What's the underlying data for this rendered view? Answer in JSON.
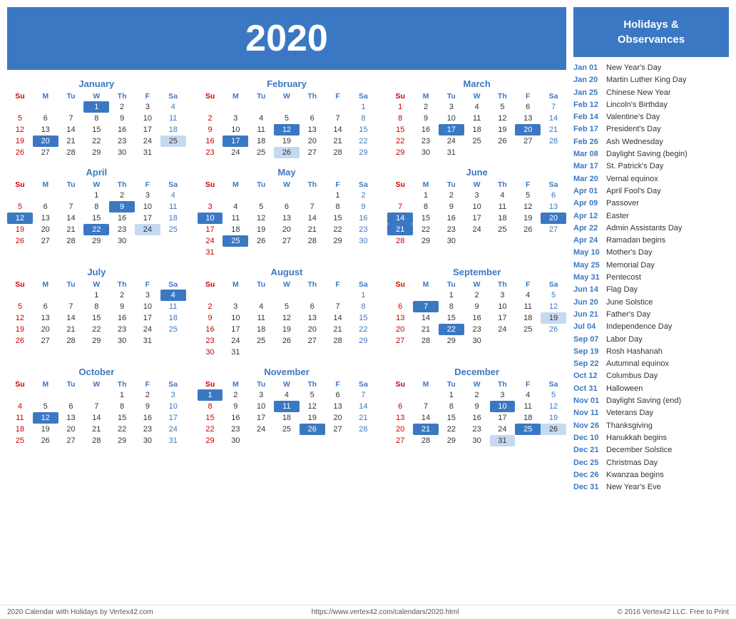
{
  "header": {
    "year": "2020"
  },
  "holidays_header": "Holidays &\nObservances",
  "holidays": [
    {
      "date": "Jan 01",
      "name": "New Year's Day"
    },
    {
      "date": "Jan 20",
      "name": "Martin Luther King Day"
    },
    {
      "date": "Jan 25",
      "name": "Chinese New Year"
    },
    {
      "date": "Feb 12",
      "name": "Lincoln's Birthday"
    },
    {
      "date": "Feb 14",
      "name": "Valentine's Day"
    },
    {
      "date": "Feb 17",
      "name": "President's Day"
    },
    {
      "date": "Feb 26",
      "name": "Ash Wednesday"
    },
    {
      "date": "Mar 08",
      "name": "Daylight Saving (begin)"
    },
    {
      "date": "Mar 17",
      "name": "St. Patrick's Day"
    },
    {
      "date": "Mar 20",
      "name": "Vernal equinox"
    },
    {
      "date": "Apr 01",
      "name": "April Fool's Day"
    },
    {
      "date": "Apr 09",
      "name": "Passover"
    },
    {
      "date": "Apr 12",
      "name": "Easter"
    },
    {
      "date": "Apr 22",
      "name": "Admin Assistants Day"
    },
    {
      "date": "Apr 24",
      "name": "Ramadan begins"
    },
    {
      "date": "May 10",
      "name": "Mother's Day"
    },
    {
      "date": "May 25",
      "name": "Memorial Day"
    },
    {
      "date": "May 31",
      "name": "Pentecost"
    },
    {
      "date": "Jun 14",
      "name": "Flag Day"
    },
    {
      "date": "Jun 20",
      "name": "June Solstice"
    },
    {
      "date": "Jun 21",
      "name": "Father's Day"
    },
    {
      "date": "Jul 04",
      "name": "Independence Day"
    },
    {
      "date": "Sep 07",
      "name": "Labor Day"
    },
    {
      "date": "Sep 19",
      "name": "Rosh Hashanah"
    },
    {
      "date": "Sep 22",
      "name": "Autumnal equinox"
    },
    {
      "date": "Oct 12",
      "name": "Columbus Day"
    },
    {
      "date": "Oct 31",
      "name": "Halloween"
    },
    {
      "date": "Nov 01",
      "name": "Daylight Saving (end)"
    },
    {
      "date": "Nov 11",
      "name": "Veterans Day"
    },
    {
      "date": "Nov 26",
      "name": "Thanksgiving"
    },
    {
      "date": "Dec 10",
      "name": "Hanukkah begins"
    },
    {
      "date": "Dec 21",
      "name": "December Solstice"
    },
    {
      "date": "Dec 25",
      "name": "Christmas Day"
    },
    {
      "date": "Dec 26",
      "name": "Kwanzaa begins"
    },
    {
      "date": "Dec 31",
      "name": "New Year's Eve"
    }
  ],
  "footer": {
    "left": "2020 Calendar with Holidays by Vertex42.com",
    "center": "https://www.vertex42.com/calendars/2020.html",
    "right": "© 2016 Vertex42 LLC. Free to Print"
  },
  "months": [
    {
      "name": "January",
      "days": [
        [
          "",
          "",
          "",
          "1",
          "2",
          "3",
          "4"
        ],
        [
          "5",
          "6",
          "7",
          "8",
          "9",
          "10",
          "11"
        ],
        [
          "12",
          "13",
          "14",
          "15",
          "16",
          "17",
          "18"
        ],
        [
          "19",
          "20",
          "21",
          "22",
          "23",
          "24",
          "25"
        ],
        [
          "26",
          "27",
          "28",
          "29",
          "30",
          "31",
          ""
        ]
      ],
      "highlights_blue": [
        "1",
        "20"
      ],
      "highlights_light": [
        "25"
      ]
    },
    {
      "name": "February",
      "days": [
        [
          "",
          "",
          "",
          "",
          "",
          "",
          "1"
        ],
        [
          "2",
          "3",
          "4",
          "5",
          "6",
          "7",
          "8"
        ],
        [
          "9",
          "10",
          "11",
          "12",
          "13",
          "14",
          "15"
        ],
        [
          "16",
          "17",
          "18",
          "19",
          "20",
          "21",
          "22"
        ],
        [
          "23",
          "24",
          "25",
          "26",
          "27",
          "28",
          "29"
        ]
      ],
      "highlights_blue": [
        "12",
        "17"
      ],
      "highlights_light": [
        "26"
      ]
    },
    {
      "name": "March",
      "days": [
        [
          "1",
          "2",
          "3",
          "4",
          "5",
          "6",
          "7"
        ],
        [
          "8",
          "9",
          "10",
          "11",
          "12",
          "13",
          "14"
        ],
        [
          "15",
          "16",
          "17",
          "18",
          "19",
          "20",
          "21"
        ],
        [
          "22",
          "23",
          "24",
          "25",
          "26",
          "27",
          "28"
        ],
        [
          "29",
          "30",
          "31",
          "",
          "",
          "",
          ""
        ]
      ],
      "highlights_blue": [
        "17",
        "20"
      ],
      "highlights_light": []
    },
    {
      "name": "April",
      "days": [
        [
          "",
          "",
          "",
          "1",
          "2",
          "3",
          "4"
        ],
        [
          "5",
          "6",
          "7",
          "8",
          "9",
          "10",
          "11"
        ],
        [
          "12",
          "13",
          "14",
          "15",
          "16",
          "17",
          "18"
        ],
        [
          "19",
          "20",
          "21",
          "22",
          "23",
          "24",
          "25"
        ],
        [
          "26",
          "27",
          "28",
          "29",
          "30",
          "",
          ""
        ]
      ],
      "highlights_blue": [
        "9",
        "12",
        "22"
      ],
      "highlights_light": [
        "24"
      ]
    },
    {
      "name": "May",
      "days": [
        [
          "",
          "",
          "",
          "",
          "",
          "1",
          "2"
        ],
        [
          "3",
          "4",
          "5",
          "6",
          "7",
          "8",
          "9"
        ],
        [
          "10",
          "11",
          "12",
          "13",
          "14",
          "15",
          "16"
        ],
        [
          "17",
          "18",
          "19",
          "20",
          "21",
          "22",
          "23"
        ],
        [
          "24",
          "25",
          "26",
          "27",
          "28",
          "29",
          "30"
        ],
        [
          "31",
          "",
          "",
          "",
          "",
          "",
          ""
        ]
      ],
      "highlights_blue": [
        "10",
        "25"
      ],
      "highlights_light": []
    },
    {
      "name": "June",
      "days": [
        [
          "",
          "1",
          "2",
          "3",
          "4",
          "5",
          "6"
        ],
        [
          "7",
          "8",
          "9",
          "10",
          "11",
          "12",
          "13"
        ],
        [
          "14",
          "15",
          "16",
          "17",
          "18",
          "19",
          "20"
        ],
        [
          "21",
          "22",
          "23",
          "24",
          "25",
          "26",
          "27"
        ],
        [
          "28",
          "29",
          "30",
          "",
          "",
          "",
          ""
        ]
      ],
      "highlights_blue": [
        "14",
        "20",
        "21"
      ],
      "highlights_light": []
    },
    {
      "name": "July",
      "days": [
        [
          "",
          "",
          "",
          "1",
          "2",
          "3",
          "4"
        ],
        [
          "5",
          "6",
          "7",
          "8",
          "9",
          "10",
          "11"
        ],
        [
          "12",
          "13",
          "14",
          "15",
          "16",
          "17",
          "18"
        ],
        [
          "19",
          "20",
          "21",
          "22",
          "23",
          "24",
          "25"
        ],
        [
          "26",
          "27",
          "28",
          "29",
          "30",
          "31",
          ""
        ]
      ],
      "highlights_blue": [
        "4"
      ],
      "highlights_light": []
    },
    {
      "name": "August",
      "days": [
        [
          "",
          "",
          "",
          "",
          "",
          "",
          "1"
        ],
        [
          "2",
          "3",
          "4",
          "5",
          "6",
          "7",
          "8"
        ],
        [
          "9",
          "10",
          "11",
          "12",
          "13",
          "14",
          "15"
        ],
        [
          "16",
          "17",
          "18",
          "19",
          "20",
          "21",
          "22"
        ],
        [
          "23",
          "24",
          "25",
          "26",
          "27",
          "28",
          "29"
        ],
        [
          "30",
          "31",
          "",
          "",
          "",
          "",
          ""
        ]
      ],
      "highlights_blue": [],
      "highlights_light": []
    },
    {
      "name": "September",
      "days": [
        [
          "",
          "",
          "1",
          "2",
          "3",
          "4",
          "5"
        ],
        [
          "6",
          "7",
          "8",
          "9",
          "10",
          "11",
          "12"
        ],
        [
          "13",
          "14",
          "15",
          "16",
          "17",
          "18",
          "19"
        ],
        [
          "20",
          "21",
          "22",
          "23",
          "24",
          "25",
          "26"
        ],
        [
          "27",
          "28",
          "29",
          "30",
          "",
          "",
          ""
        ]
      ],
      "highlights_blue": [
        "7",
        "22"
      ],
      "highlights_light": [
        "19"
      ]
    },
    {
      "name": "October",
      "days": [
        [
          "",
          "",
          "",
          "",
          "1",
          "2",
          "3"
        ],
        [
          "4",
          "5",
          "6",
          "7",
          "8",
          "9",
          "10"
        ],
        [
          "11",
          "12",
          "13",
          "14",
          "15",
          "16",
          "17"
        ],
        [
          "18",
          "19",
          "20",
          "21",
          "22",
          "23",
          "24"
        ],
        [
          "25",
          "26",
          "27",
          "28",
          "29",
          "30",
          "31"
        ]
      ],
      "highlights_blue": [
        "12"
      ],
      "highlights_light": []
    },
    {
      "name": "November",
      "days": [
        [
          "1",
          "2",
          "3",
          "4",
          "5",
          "6",
          "7"
        ],
        [
          "8",
          "9",
          "10",
          "11",
          "12",
          "13",
          "14"
        ],
        [
          "15",
          "16",
          "17",
          "18",
          "19",
          "20",
          "21"
        ],
        [
          "22",
          "23",
          "24",
          "25",
          "26",
          "27",
          "28"
        ],
        [
          "29",
          "30",
          "",
          "",
          "",
          "",
          ""
        ]
      ],
      "highlights_blue": [
        "1",
        "11",
        "26"
      ],
      "highlights_light": []
    },
    {
      "name": "December",
      "days": [
        [
          "",
          "",
          "1",
          "2",
          "3",
          "4",
          "5"
        ],
        [
          "6",
          "7",
          "8",
          "9",
          "10",
          "11",
          "12"
        ],
        [
          "13",
          "14",
          "15",
          "16",
          "17",
          "18",
          "19"
        ],
        [
          "20",
          "21",
          "22",
          "23",
          "24",
          "25",
          "26"
        ],
        [
          "27",
          "28",
          "29",
          "30",
          "31",
          "",
          ""
        ]
      ],
      "highlights_blue": [
        "10",
        "21",
        "25"
      ],
      "highlights_light": [
        "26",
        "31"
      ]
    }
  ]
}
